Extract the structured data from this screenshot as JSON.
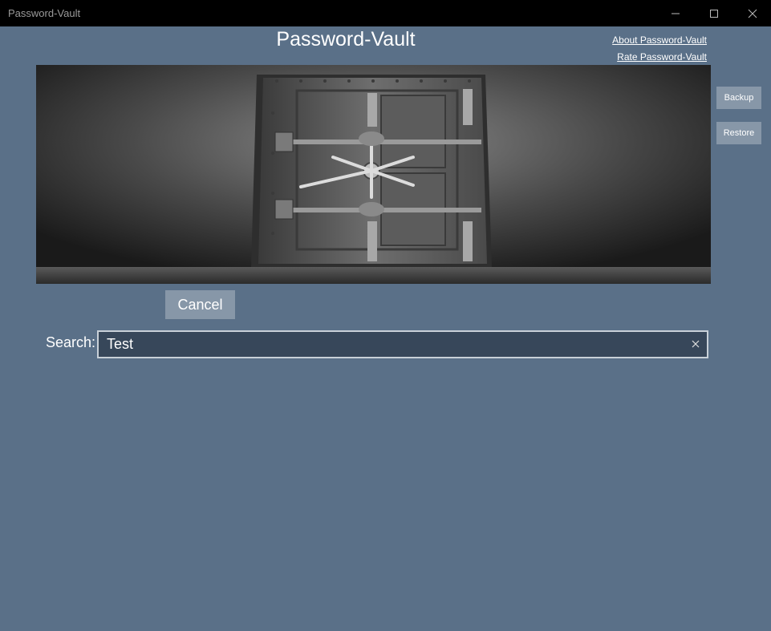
{
  "window": {
    "title": "Password-Vault"
  },
  "header": {
    "title": "Password-Vault",
    "about_link": "About Password-Vault",
    "rate_link": "Rate Password-Vault"
  },
  "side_actions": {
    "backup_label": "Backup",
    "restore_label": "Restore"
  },
  "main": {
    "cancel_label": "Cancel",
    "search_label": "Search:",
    "search_value": "Test"
  },
  "icons": {
    "minimize": "minimize-icon",
    "maximize": "maximize-icon",
    "close": "close-icon",
    "clear": "clear-icon"
  },
  "colors": {
    "background": "#5a7088",
    "titlebar": "#000000",
    "button": "#8797a8",
    "search_field": "#37475a"
  }
}
